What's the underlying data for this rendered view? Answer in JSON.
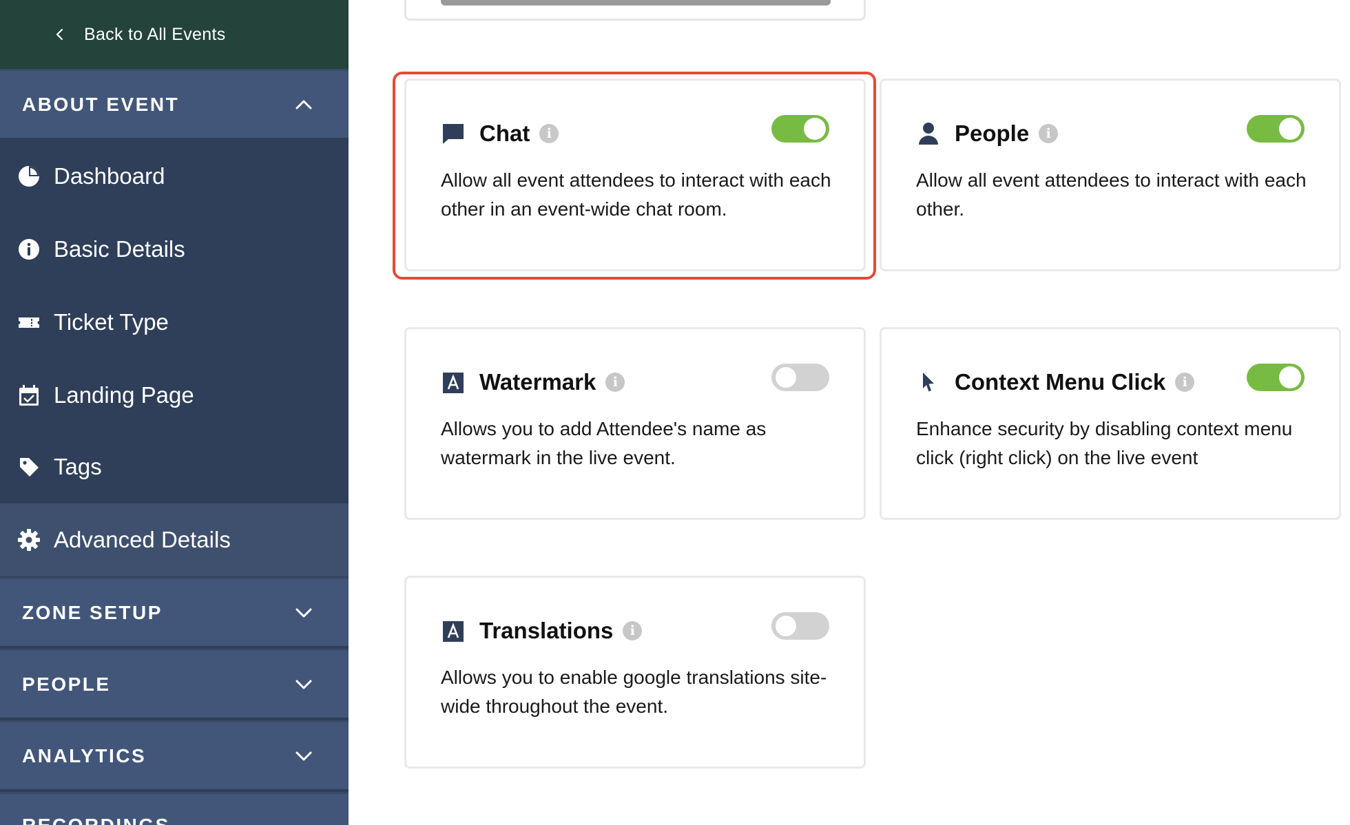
{
  "sidebar": {
    "back_label": "Back to All Events",
    "sections": {
      "about_event": "ABOUT EVENT",
      "zone_setup": "ZONE SETUP",
      "people": "PEOPLE",
      "analytics": "ANALYTICS",
      "recordings": "RECORDINGS"
    },
    "items": [
      {
        "label": "Dashboard",
        "icon": "pie-chart-icon"
      },
      {
        "label": "Basic Details",
        "icon": "info-circle-icon"
      },
      {
        "label": "Ticket Type",
        "icon": "ticket-icon"
      },
      {
        "label": "Landing Page",
        "icon": "calendar-check-icon"
      },
      {
        "label": "Tags",
        "icon": "tag-icon"
      },
      {
        "label": "Advanced Details",
        "icon": "gear-icon",
        "active": true
      }
    ]
  },
  "features": [
    {
      "id": "chat",
      "title": "Chat",
      "icon": "chat-bubble-icon",
      "enabled": true,
      "highlighted": true,
      "description": "Allow all event attendees to interact with each other in an event-wide chat room."
    },
    {
      "id": "people",
      "title": "People",
      "icon": "person-icon",
      "enabled": true,
      "description": "Allow all event attendees to interact with each other."
    },
    {
      "id": "watermark",
      "title": "Watermark",
      "icon": "letter-a-icon",
      "enabled": false,
      "description": "Allows you to add Attendee's name as watermark in the live event."
    },
    {
      "id": "context-menu",
      "title": "Context Menu Click",
      "icon": "cursor-icon",
      "enabled": true,
      "description": "Enhance security by disabling context menu click (right click) on the live event"
    },
    {
      "id": "translations",
      "title": "Translations",
      "icon": "letter-a-icon",
      "enabled": false,
      "description": "Allows you to enable google translations site-wide throughout the event."
    }
  ],
  "info_glyph": "i",
  "colors": {
    "sidebar_bg": "#2f3f59",
    "back_bar_bg": "#24433b",
    "section_header_bg": "#425679",
    "toggle_on": "#78bb43",
    "toggle_off": "#d2d2d2",
    "highlight": "#e44a37"
  }
}
